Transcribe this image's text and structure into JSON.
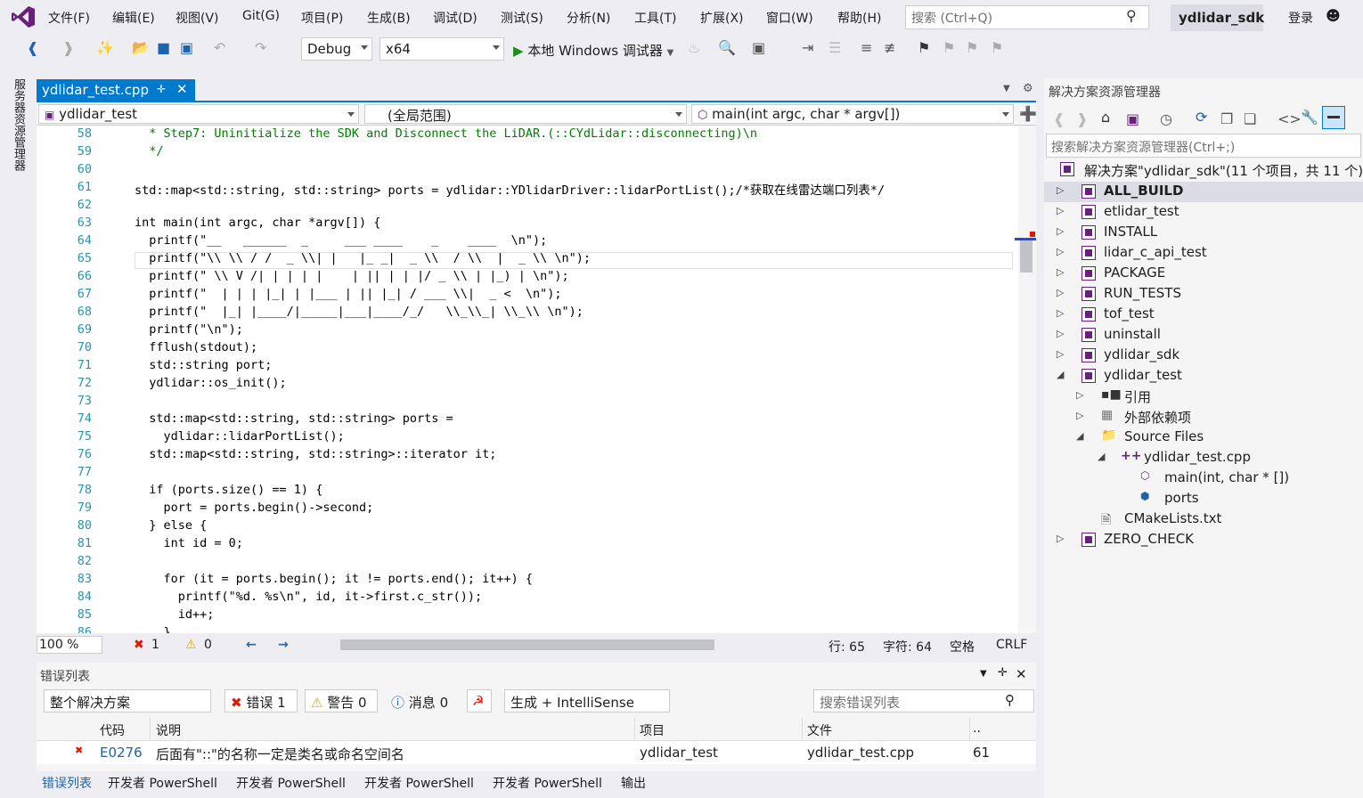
{
  "menu": [
    "文件(F)",
    "编辑(E)",
    "视图(V)",
    "Git(G)",
    "项目(P)",
    "生成(B)",
    "调试(D)",
    "测试(S)",
    "分析(N)",
    "工具(T)",
    "扩展(X)",
    "窗口(W)",
    "帮助(H)"
  ],
  "search": {
    "placeholder": "搜索 (Ctrl+Q)"
  },
  "solution_badge": "ydlidar_sdk",
  "login": "登录",
  "toolbar": {
    "config": "Debug",
    "platform": "x64",
    "run_label": "本地 Windows 调试器"
  },
  "left_panel": "服务器资源管理器",
  "editor": {
    "tab_title": "ydlidar_test.cpp",
    "nav": {
      "project": "ydlidar_test",
      "scope": "(全局范围)",
      "member": "main(int argc, char * argv[])"
    },
    "lines": [
      {
        "n": "58",
        "t": "  * Step7: Uninitialize the SDK and Disconnect the LiDAR.(::CYdLidar::disconnecting)\\n"
      },
      {
        "n": "59",
        "t": "  */"
      },
      {
        "n": "60",
        "t": ""
      },
      {
        "n": "61",
        "t": "std::map<std::string, std::string> ports = ydlidar::YDlidarDriver::lidarPortList();/*获取在线雷达端口列表*/"
      },
      {
        "n": "62",
        "t": ""
      },
      {
        "n": "63",
        "t": "int main(int argc, char *argv[]) {"
      },
      {
        "n": "64",
        "t": "  printf(\"__   ______  _     ___ ____    _    ____  \\n\");"
      },
      {
        "n": "65",
        "t": "  printf(\"\\\\ \\\\ / /  _ \\\\| |   |_ _|  _ \\\\  / \\\\  |  _ \\\\ \\n\");"
      },
      {
        "n": "66",
        "t": "  printf(\" \\\\ V /| | | | |    | || | | |/ _ \\\\ | |_) | \\n\");"
      },
      {
        "n": "67",
        "t": "  printf(\"  | | | |_| | |___ | || |_| / ___ \\\\|  _ <  \\n\");"
      },
      {
        "n": "68",
        "t": "  printf(\"  |_| |____/|_____|___|____/_/   \\\\_\\\\_| \\\\_\\\\ \\n\");"
      },
      {
        "n": "69",
        "t": "  printf(\"\\n\");"
      },
      {
        "n": "70",
        "t": "  fflush(stdout);"
      },
      {
        "n": "71",
        "t": "  std::string port;"
      },
      {
        "n": "72",
        "t": "  ydlidar::os_init();"
      },
      {
        "n": "73",
        "t": ""
      },
      {
        "n": "74",
        "t": "  std::map<std::string, std::string> ports ="
      },
      {
        "n": "75",
        "t": "    ydlidar::lidarPortList();"
      },
      {
        "n": "76",
        "t": "  std::map<std::string, std::string>::iterator it;"
      },
      {
        "n": "77",
        "t": ""
      },
      {
        "n": "78",
        "t": "  if (ports.size() == 1) {"
      },
      {
        "n": "79",
        "t": "    port = ports.begin()->second;"
      },
      {
        "n": "80",
        "t": "  } else {"
      },
      {
        "n": "81",
        "t": "    int id = 0;"
      },
      {
        "n": "82",
        "t": ""
      },
      {
        "n": "83",
        "t": "    for (it = ports.begin(); it != ports.end(); it++) {"
      },
      {
        "n": "84",
        "t": "      printf(\"%d. %s\\n\", id, it->first.c_str());"
      },
      {
        "n": "85",
        "t": "      id++;"
      },
      {
        "n": "86",
        "t": "    }"
      }
    ],
    "status": {
      "zoom": "100 %",
      "errors": "1",
      "warnings": "0",
      "line": "行: 65",
      "char": "字符: 64",
      "space": "空格",
      "eol": "CRLF"
    }
  },
  "error_list": {
    "title": "错误列表",
    "scope": "整个解决方案",
    "errors_btn": "错误 1",
    "warnings_btn": "警告 0",
    "messages_btn": "消息 0",
    "source": "生成 + IntelliSense",
    "search_placeholder": "搜索错误列表",
    "headers": {
      "code": "代码",
      "desc": "说明",
      "project": "项目",
      "file": "文件",
      "line": ".."
    },
    "row": {
      "code": "E0276",
      "desc": "后面有\"::\"的名称一定是类名或命名空间名",
      "project": "ydlidar_test",
      "file": "ydlidar_test.cpp",
      "line": "61"
    }
  },
  "bottom_tabs": [
    "错误列表",
    "开发者 PowerShell",
    "开发者 PowerShell",
    "开发者 PowerShell",
    "开发者 PowerShell",
    "输出"
  ],
  "solution_explorer": {
    "title": "解决方案资源管理器",
    "search_placeholder": "搜索解决方案资源管理器(Ctrl+;)",
    "root": "解决方案\"ydlidar_sdk\"(11 个项目，共 11 个)",
    "items": [
      {
        "label": "ALL_BUILD",
        "bold": true
      },
      {
        "label": "etlidar_test"
      },
      {
        "label": "INSTALL"
      },
      {
        "label": "lidar_c_api_test"
      },
      {
        "label": "PACKAGE"
      },
      {
        "label": "RUN_TESTS"
      },
      {
        "label": "tof_test"
      },
      {
        "label": "uninstall"
      },
      {
        "label": "ydlidar_sdk"
      },
      {
        "label": "ydlidar_test"
      }
    ],
    "children": {
      "references": "引用",
      "external": "外部依赖项",
      "source_files": "Source Files",
      "cpp": "ydlidar_test.cpp",
      "main_fn": "main(int, char * [])",
      "ports": "ports",
      "cmake": "CMakeLists.txt",
      "zero_check": "ZERO_CHECK"
    }
  }
}
